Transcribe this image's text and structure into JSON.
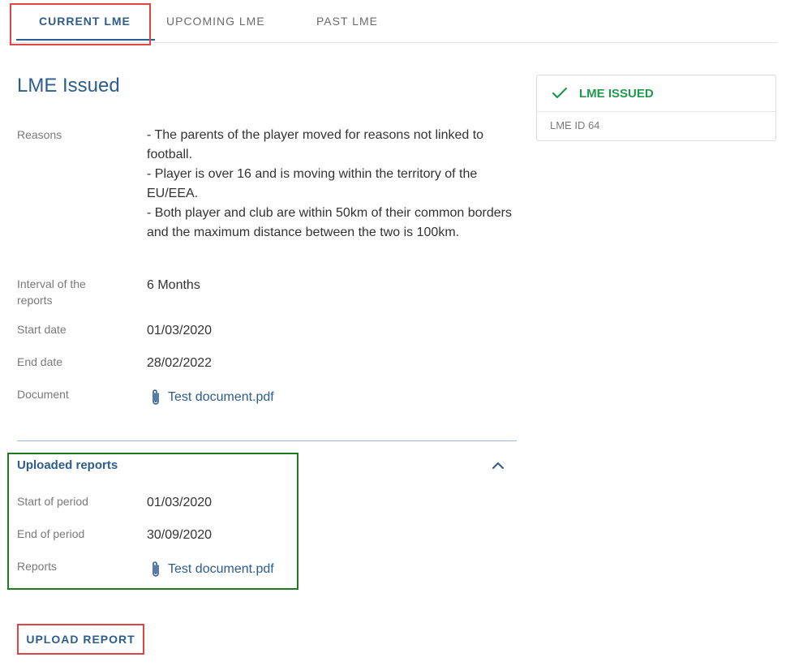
{
  "tabs": [
    {
      "label": "CURRENT LME",
      "active": true
    },
    {
      "label": "UPCOMING LME",
      "active": false
    },
    {
      "label": "PAST LME",
      "active": false
    }
  ],
  "page_title": "LME Issued",
  "details": {
    "reasons_label": "Reasons",
    "reasons": [
      "- The parents of the player moved for reasons not linked to football.",
      "- Player is over 16 and is moving within the territory of the EU/EEA.",
      "- Both player and club are within 50km of their common borders and the maximum distance between the two is 100km."
    ],
    "interval_label": "Interval of the reports",
    "interval_value": "6 Months",
    "start_label": "Start date",
    "start_value": "01/03/2020",
    "end_label": "End date",
    "end_value": "28/02/2022",
    "document_label": "Document",
    "document_value": "Test document.pdf"
  },
  "uploaded_reports": {
    "title": "Uploaded reports",
    "start_label": "Start of period",
    "start_value": "01/03/2020",
    "end_label": "End of period",
    "end_value": "30/09/2020",
    "reports_label": "Reports",
    "reports_value": "Test document.pdf"
  },
  "upload_button": "UPLOAD REPORT",
  "status_card": {
    "status": "LME ISSUED",
    "id_text": "LME ID 64"
  },
  "icons": {
    "check": "check-icon",
    "attachment": "paperclip-icon",
    "collapse": "chevron-up-icon"
  },
  "colors": {
    "accent": "#2c5d8c",
    "success": "#1f9a4a",
    "highlight_red": "#e04545",
    "highlight_green": "#1f7a1f"
  }
}
